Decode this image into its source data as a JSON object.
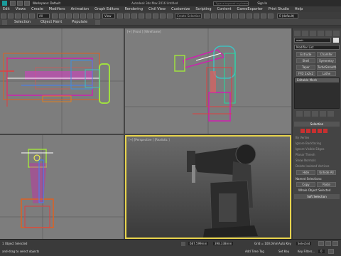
{
  "titlebar": {
    "workspace": "Workspace: Default",
    "title": "Autodesk 3ds Max 2016   Untitled",
    "search_placeholder": "Type a keyword or phrase",
    "signin": "Sign In"
  },
  "menubar": {
    "items": [
      "Edit",
      "Views",
      "Create",
      "Modifiers",
      "Animation",
      "Graph Editors",
      "Rendering",
      "Civil View",
      "Customize",
      "Scripting",
      "Content",
      "GameExporter",
      "Print Studio",
      "Help"
    ]
  },
  "toolbar": {
    "selection_filter": "All",
    "view_dropdown": "View",
    "named_selection_placeholder": "Create Selection Se",
    "layer": "0 (default)"
  },
  "ribbon": {
    "tabs": [
      "Selection",
      "Object Paint",
      "Populate"
    ]
  },
  "viewports": {
    "front_label": "[+] [Front ] [Wireframe]",
    "persp_label": "[+] [Perspective ] [Realistic ]"
  },
  "command_panel": {
    "object_name": "mesh",
    "modifier_list": "Modifier List",
    "modifier_buttons": [
      "Extrude",
      "Chamfer",
      "Shell",
      "Symmetry",
      "Taper",
      "TurboSmooth",
      "FFD 2x2x2",
      "Lathe"
    ],
    "stack_item": "Editable Mesh",
    "selection_rollout": "Selection",
    "checkboxes": [
      "By Vertex",
      "Ignore Backfacing",
      "Ignore Visible Edges",
      "Planar Thresh",
      "Show Normals",
      "Delete Isolated Vertices"
    ],
    "hide": "Hide",
    "unhide_all": "Unhide All",
    "named_selections": "Named Selections:",
    "copy": "Copy",
    "paste": "Paste",
    "whole_object": "Whole Object Selected",
    "soft_selection": "Soft Selection"
  },
  "statusbar": {
    "selection": "1 Object Selected",
    "prompt": "and-drag to select objects",
    "x_value": "687.599mm",
    "y_value": "398.338mm",
    "grid": "Grid = 100.0mm",
    "auto_key": "Auto Key",
    "set_key": "Set Key",
    "key_mode": "Selected",
    "key_filters": "Key Filters...",
    "add_time_tag": "Add Time Tag",
    "frame": "0"
  }
}
